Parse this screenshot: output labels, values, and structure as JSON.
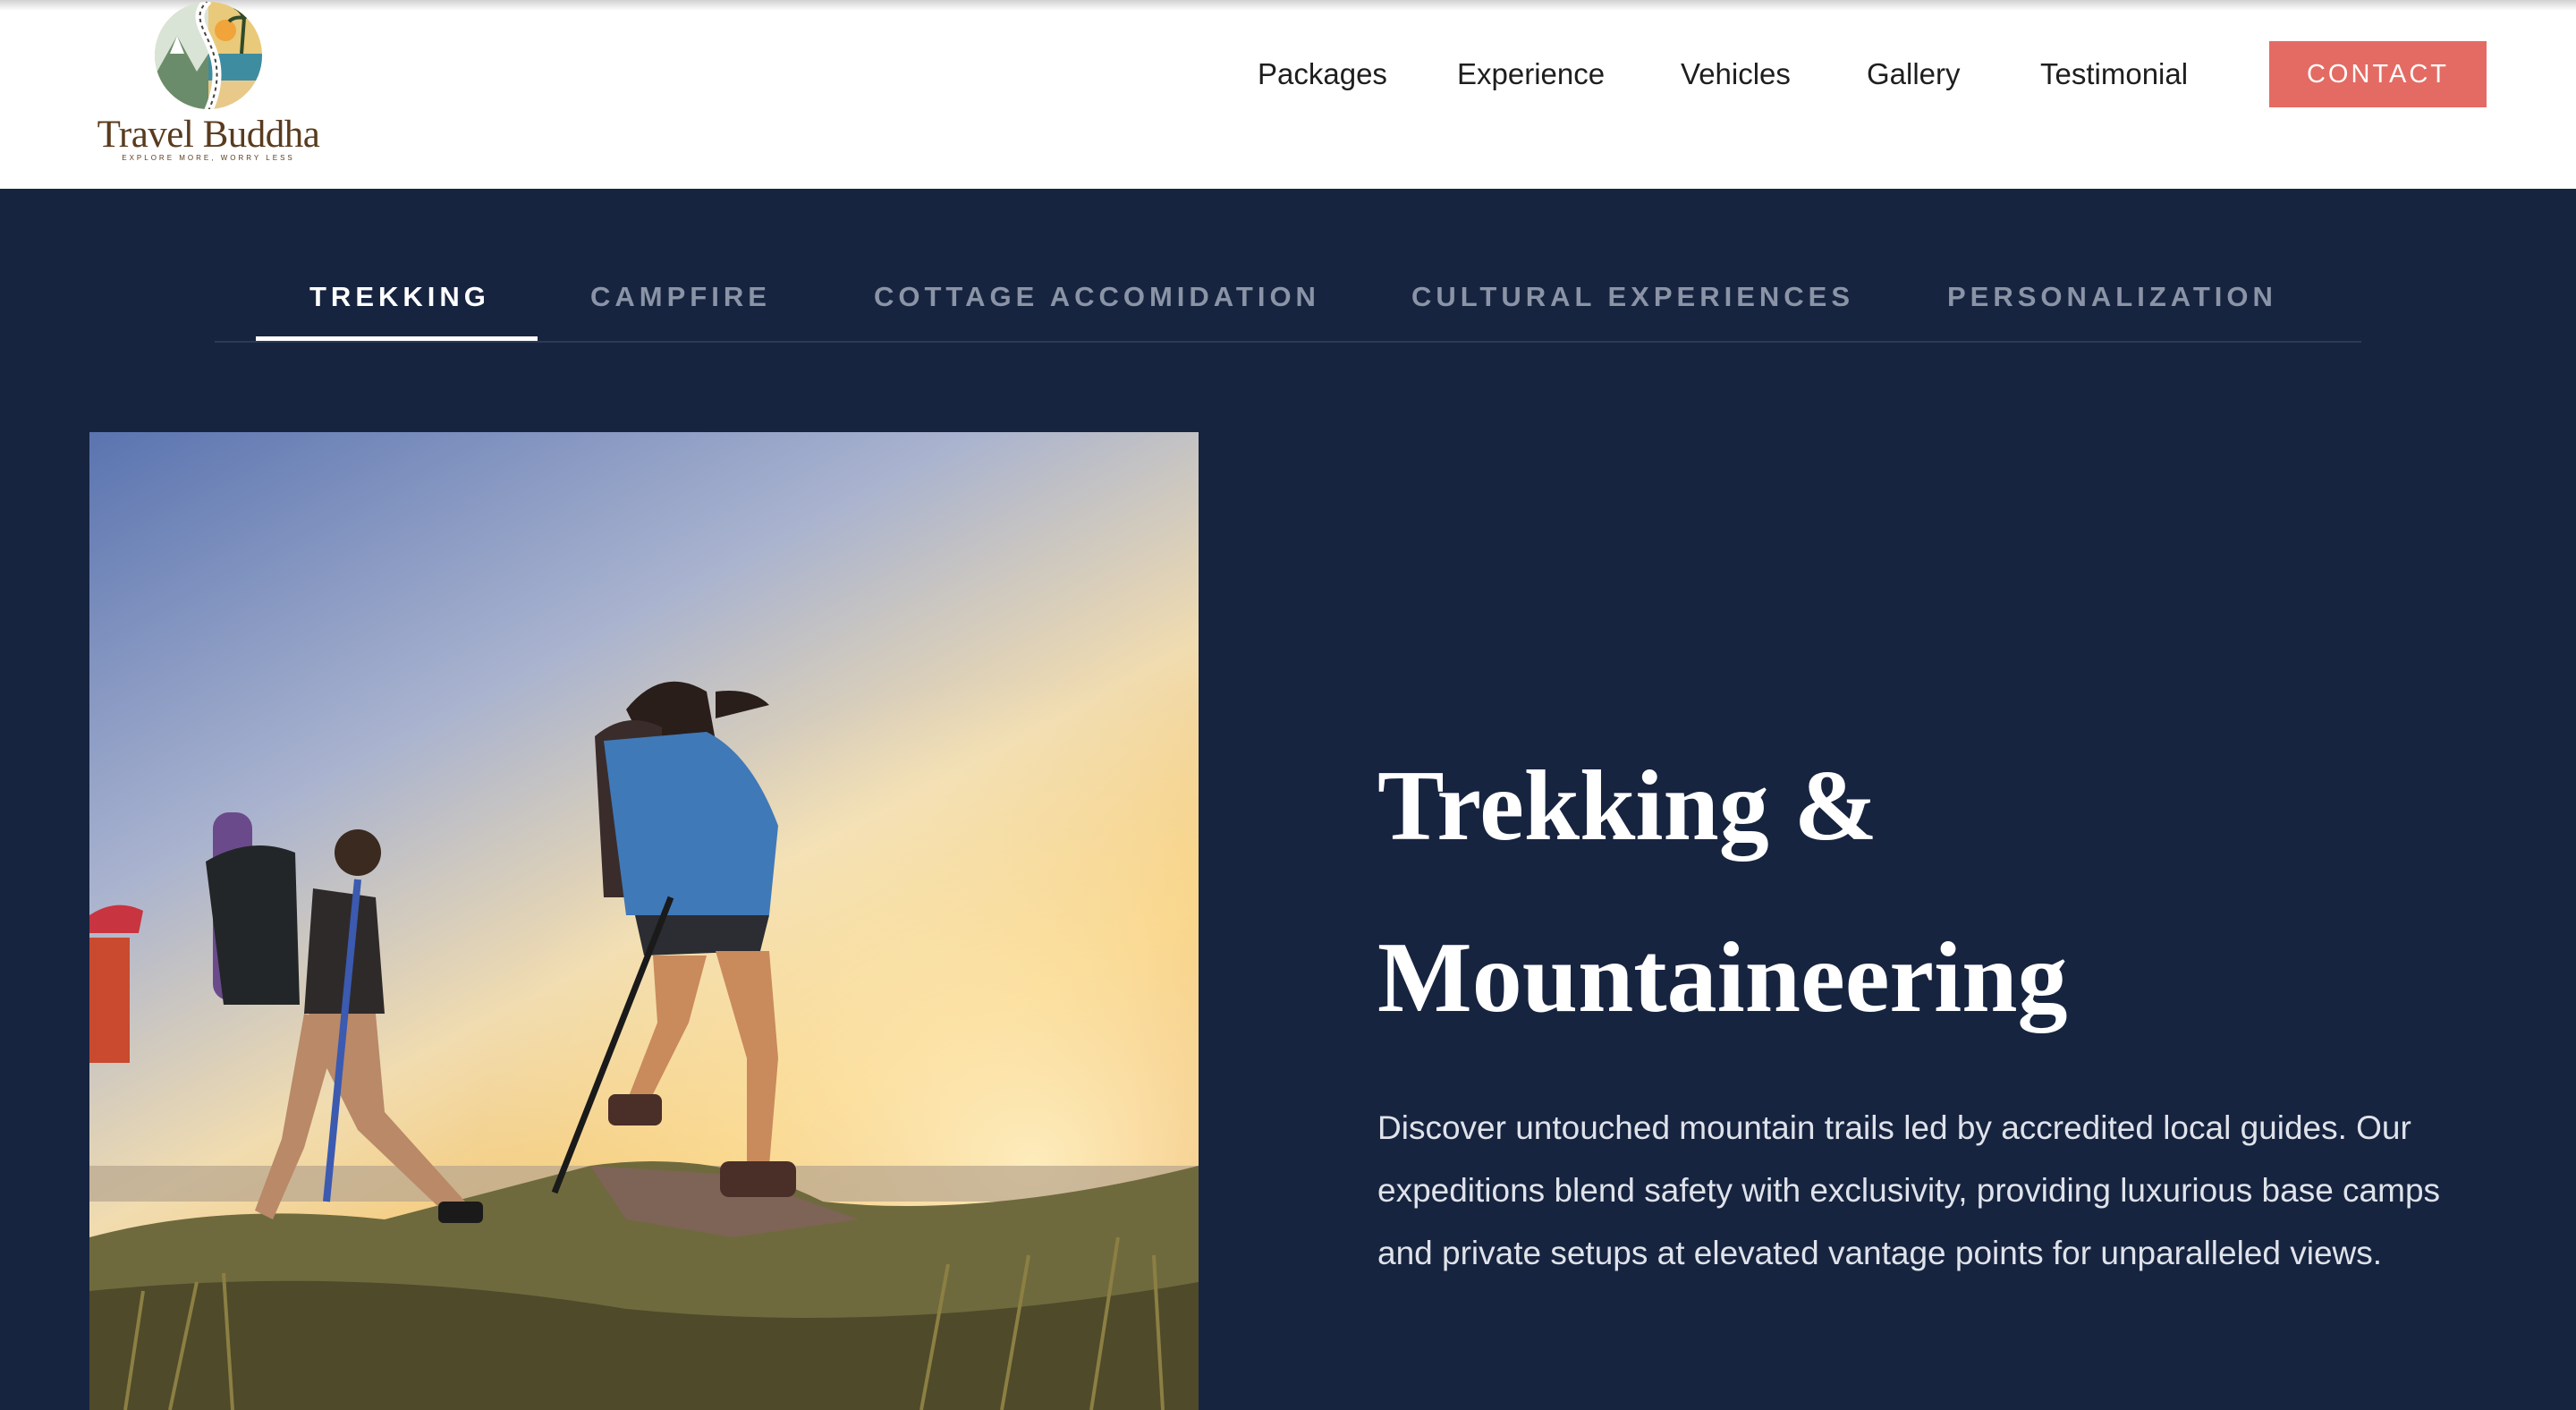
{
  "brand": {
    "name": "Travel Buddha",
    "tagline": "EXPLORE MORE, WORRY LESS"
  },
  "nav": {
    "items": [
      "Packages",
      "Experience",
      "Vehicles",
      "Gallery",
      "Testimonial"
    ],
    "contact_label": "CONTACT"
  },
  "tabs": {
    "items": [
      "TREKKING",
      "CAMPFIRE",
      "COTTAGE ACCOMIDATION",
      "CULTURAL EXPERIENCES",
      "PERSONALIZATION"
    ],
    "active": "TREKKING"
  },
  "feature": {
    "title_line1": "Trekking &",
    "title_line2": "Mountaineering",
    "description": "Discover untouched mountain trails led by accredited local guides. Our expeditions blend safety with exclusivity, providing luxurious base camps and private setups at elevated vantage points for unparalleled views.",
    "image_alt_icon": "hikers-photo"
  },
  "colors": {
    "background": "#172440",
    "accent": "#e36b63",
    "brand_brown": "#5a3b1e"
  }
}
